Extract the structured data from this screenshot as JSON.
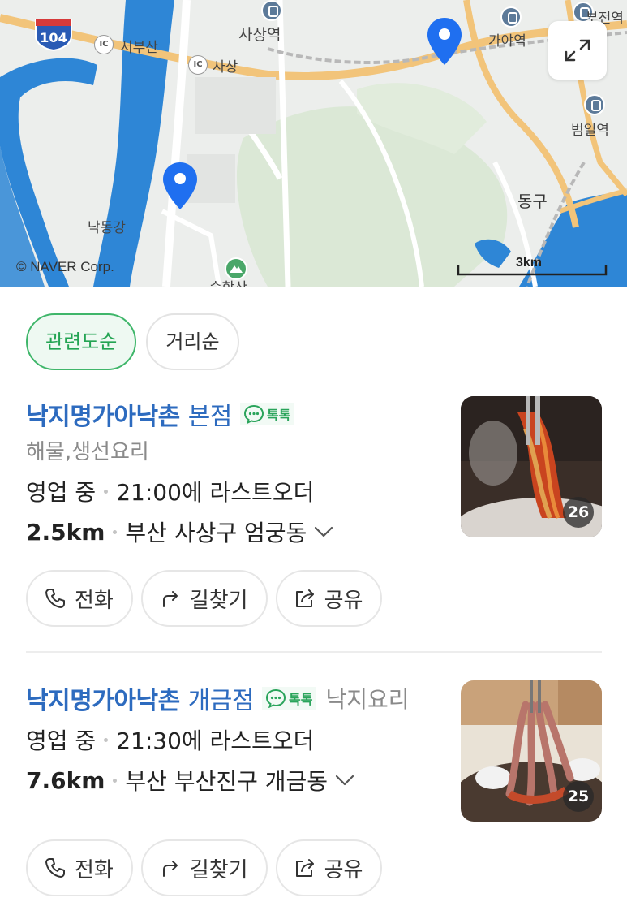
{
  "map": {
    "labels": {
      "route_number": "104",
      "ic_badge": "IC",
      "seobusan": "서부산",
      "sasang_ic": "사상",
      "sasang_station": "사상역",
      "sasang_station_top": "사상",
      "gaya_station": "가야역",
      "busanjin_station": "부전역",
      "beomil_station": "범일역",
      "dong_gu": "동구",
      "nakdong_river": "낙동강",
      "suhak_mountain": "승학산"
    },
    "copyright": "© NAVER Corp.",
    "scale": "3km",
    "colors": {
      "pin": "#1f6ff0",
      "road": "#f2c47a",
      "water": "#2e86d6",
      "land": "#eceeec",
      "green": "#d7e6d3"
    }
  },
  "filters": [
    {
      "label": "관련도순",
      "active": true
    },
    {
      "label": "거리순",
      "active": false
    }
  ],
  "results": [
    {
      "name": "낙지명가아낙촌",
      "branch": "본점",
      "talk_label": "톡톡",
      "category": "해물,생선요리",
      "status": "영업 중",
      "last_order": "21:00에 라스트오더",
      "distance": "2.5km",
      "address": "부산 사상구 엄궁동",
      "photo_count": "26",
      "actions": {
        "call": "전화",
        "directions": "길찾기",
        "share": "공유"
      }
    },
    {
      "name": "낙지명가아낙촌",
      "branch": "개금점",
      "talk_label": "톡톡",
      "category": "낙지요리",
      "status": "영업 중",
      "last_order": "21:30에 라스트오더",
      "distance": "7.6km",
      "address": "부산 부산진구 개금동",
      "photo_count": "25",
      "actions": {
        "call": "전화",
        "directions": "길찾기",
        "share": "공유"
      }
    }
  ],
  "icons": [
    "pin-icon",
    "expand-icon",
    "talk-icon",
    "phone-icon",
    "directions-icon",
    "share-icon",
    "chevron-down-icon",
    "station-icon",
    "mountain-icon"
  ]
}
